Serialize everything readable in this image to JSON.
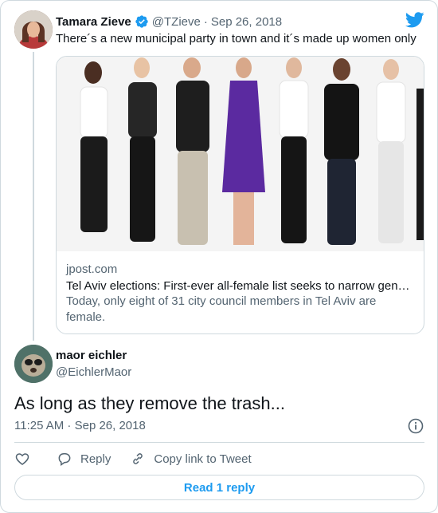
{
  "tweet": {
    "author_name": "Tamara Zieve",
    "author_handle": "@TZieve",
    "date": "Sep 26, 2018",
    "text": "There´s a new municipal party in town and it´s made up women only",
    "card": {
      "domain": "jpost.com",
      "title": "Tel Aviv elections: First-ever all-female list seeks to narrow gen…",
      "description": "Today, only eight of 31 city council members in Tel Aviv are female."
    }
  },
  "reply": {
    "author_name": "maor eichler",
    "author_handle": "@EichlerMaor",
    "text": "As long as they remove the trash...",
    "timestamp": "11:25 AM · Sep 26, 2018"
  },
  "actions": {
    "reply_label": "Reply",
    "copy_label": "Copy link to Tweet",
    "read_replies_label": "Read 1 reply"
  },
  "icons": {
    "verified": "verified-badge-icon",
    "brand": "twitter-bird-icon",
    "info": "info-icon",
    "like": "heart-icon",
    "reply": "comment-icon",
    "copy": "link-icon"
  },
  "colors": {
    "accent": "#1d9bf0",
    "text_primary": "#0f1419",
    "text_secondary": "#536471",
    "border": "#cfd9de"
  }
}
